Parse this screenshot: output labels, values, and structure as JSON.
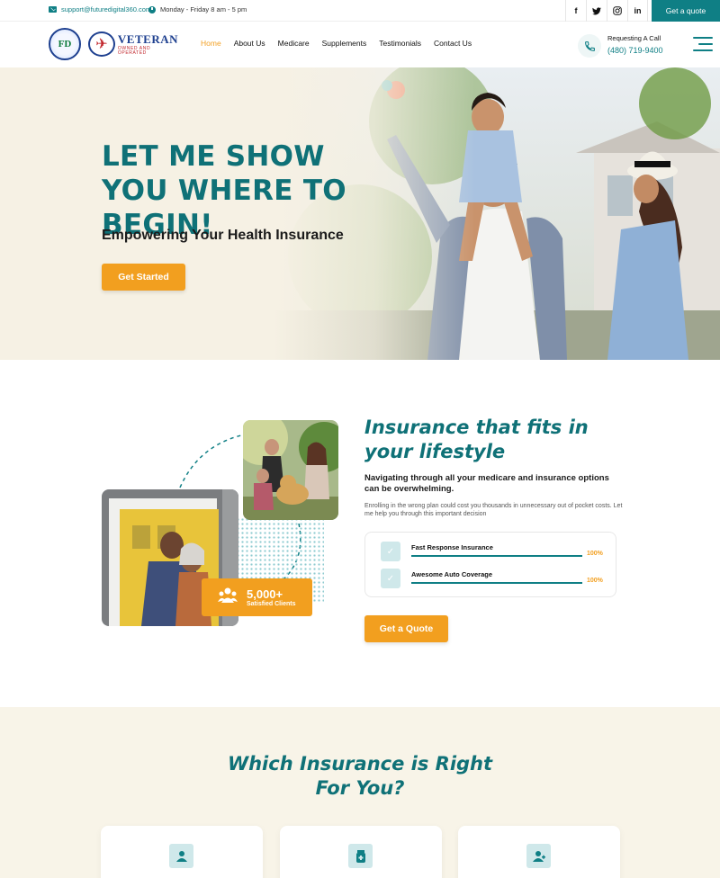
{
  "topbar": {
    "email": "support@futuredigital360.com",
    "hours": "Monday - Friday 8 am - 5 pm",
    "socials": [
      "f",
      "twitter",
      "instagram",
      "in"
    ],
    "quote_label": "Get a quote"
  },
  "header": {
    "logo_fd": "FD",
    "logo_vet_main": "VETERAN",
    "logo_vet_sub": "OWNED AND OPERATED",
    "nav": [
      "Home",
      "About Us",
      "Medicare",
      "Supplements",
      "Testimonials",
      "Contact Us"
    ],
    "call_label": "Requesting A Call",
    "phone": "(480) 719-9400"
  },
  "hero": {
    "title": "LET ME SHOW YOU WHERE TO BEGIN!",
    "subtitle": "Empowering Your Health Insurance",
    "button": "Get Started"
  },
  "lifestyle": {
    "title": "Insurance that fits in your lifestyle",
    "lead": "Navigating through all your medicare and insurance options can be overwhelming.",
    "body": "Enrolling in the wrong plan could cost you thousands in unnecessary out of pocket costs. Let me help you through this important decision",
    "clients_count": "5,000+",
    "clients_label": "Satisfied Clients",
    "skills": [
      {
        "label": "Fast Response Insurance",
        "percent": "100%",
        "level": 1.0
      },
      {
        "label": "Awesome Auto Coverage",
        "percent": "100%",
        "level": 1.0
      }
    ],
    "button": "Get a Quote"
  },
  "insurance": {
    "title": "Which Insurance is Right For You?",
    "card_icons": [
      "doctor-icon",
      "medicine-bottle-icon",
      "user-plus-icon"
    ]
  },
  "colors": {
    "teal": "#0f7f85",
    "orange": "#f29f1f",
    "cream": "#f8f4e8"
  }
}
